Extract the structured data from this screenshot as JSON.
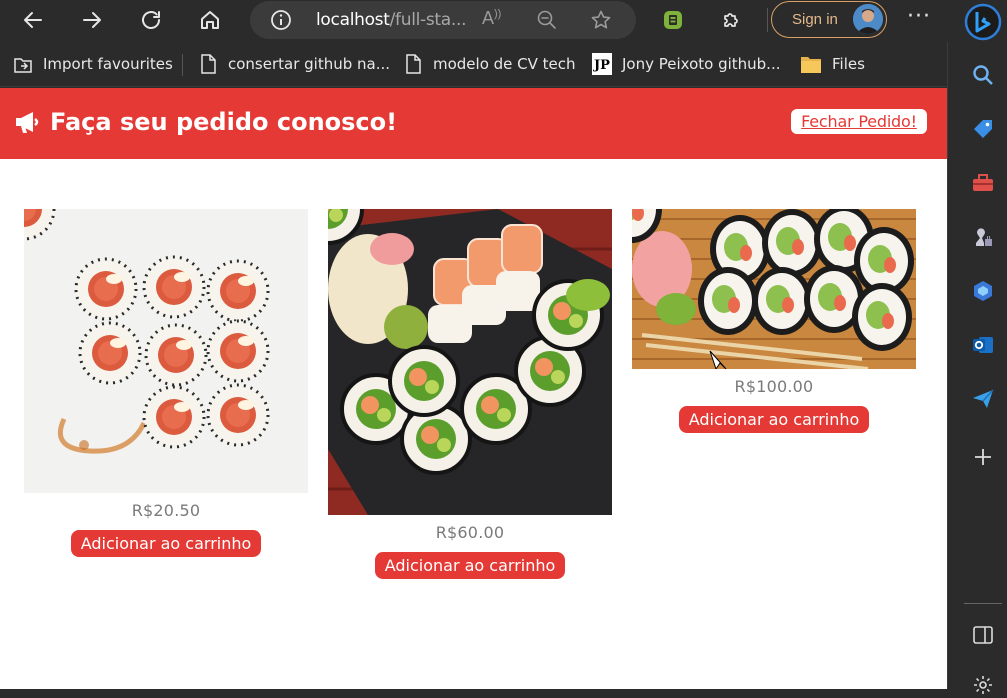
{
  "browser": {
    "url_host": "localhost",
    "url_rest": "/full-sta...",
    "read_aloud_label": "A",
    "signin_label": "Sign in",
    "more_label": "···"
  },
  "bookmarks": [
    {
      "label": "Import favourites",
      "icon": "import-icon"
    },
    {
      "label": "consertar github na...",
      "icon": "page-icon"
    },
    {
      "label": "modelo de CV tech",
      "icon": "page-icon"
    },
    {
      "label": "Jony Peixoto github...",
      "icon": "jp-logo-icon"
    },
    {
      "label": "Files",
      "icon": "folder-icon"
    }
  ],
  "sidebar": [
    "search-icon",
    "tag-icon",
    "toolbox-icon",
    "games-icon",
    "office-icon",
    "outlook-icon",
    "send-icon",
    "add-icon",
    "split-screen-icon",
    "settings-icon"
  ],
  "header": {
    "title": "Faça seu pedido conosco!",
    "close_order": "Fechar Pedido!",
    "color": "#e53935"
  },
  "products": [
    {
      "price": "R$20.50",
      "button": "Adicionar ao carrinho"
    },
    {
      "price": "R$60.00",
      "button": "Adicionar ao carrinho"
    },
    {
      "price": "R$100.00",
      "button": "Adicionar ao carrinho"
    }
  ]
}
